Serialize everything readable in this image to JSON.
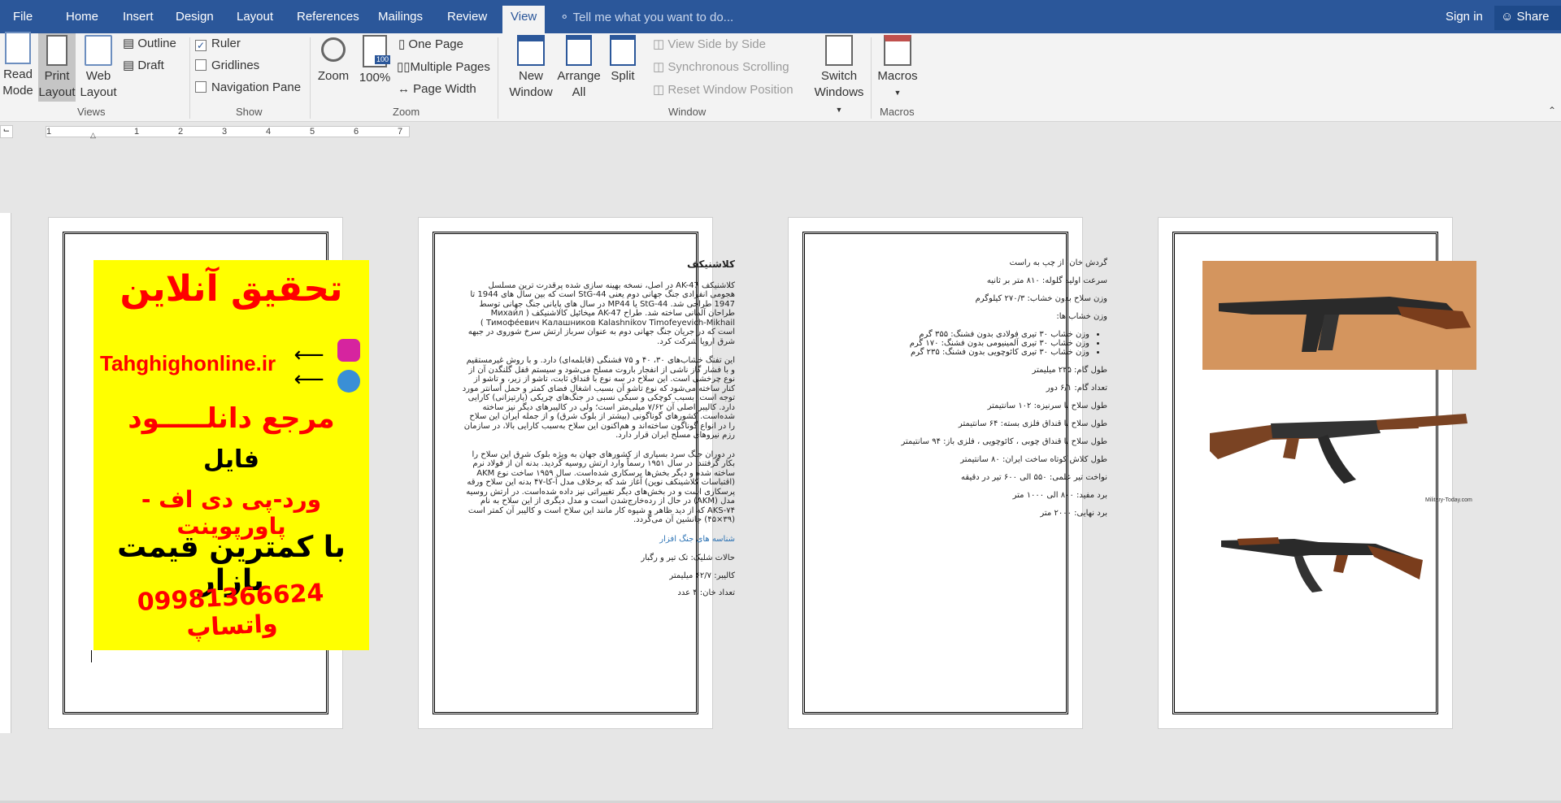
{
  "tabs": {
    "file": "File",
    "home": "Home",
    "insert": "Insert",
    "design": "Design",
    "layout": "Layout",
    "references": "References",
    "mailings": "Mailings",
    "review": "Review",
    "view": "View"
  },
  "tell_me": "Tell me what you want to do...",
  "sign_in": "Sign in",
  "share": "Share",
  "views": {
    "read_mode_1": "Read",
    "read_mode_2": "Mode",
    "print_layout_1": "Print",
    "print_layout_2": "Layout",
    "web_layout_1": "Web",
    "web_layout_2": "Layout",
    "outline": "Outline",
    "draft": "Draft",
    "group": "Views"
  },
  "show": {
    "ruler": "Ruler",
    "gridlines": "Gridlines",
    "navigation_pane": "Navigation Pane",
    "group": "Show"
  },
  "zoom": {
    "zoom": "Zoom",
    "hundred": "100%",
    "one_page": "One Page",
    "multiple_pages": "Multiple Pages",
    "page_width": "Page Width",
    "group": "Zoom",
    "icon_badge": "100"
  },
  "window": {
    "new_window_1": "New",
    "new_window_2": "Window",
    "arrange_all_1": "Arrange",
    "arrange_all_2": "All",
    "split": "Split",
    "view_side_by_side": "View Side by Side",
    "synchronous_scrolling": "Synchronous Scrolling",
    "reset_window_position": "Reset Window Position",
    "switch_windows_1": "Switch",
    "switch_windows_2": "Windows",
    "group": "Window"
  },
  "macros": {
    "label": "Macros",
    "group": "Macros"
  },
  "ruler_numbers": [
    "1",
    "1",
    "2",
    "3",
    "4",
    "5",
    "6",
    "7"
  ],
  "page1": {
    "title": "تحقیق آنلاین",
    "site": "Tahghighonline.ir",
    "line1": "مرجع دانلـــــود",
    "line2": "فایل",
    "line3": "ورد-پی دی اف - پاورپوینت",
    "line4": "با کمترین قیمت بازار",
    "phone": "09981366624",
    "whatsapp": "واتساپ"
  },
  "page2": {
    "heading": "کلاشنیکف",
    "para1": "کلاشنیکف AK-47 در اصل، نسخه بهینه سازی شده پرقدرت ترین مسلسل هجومی انفرادی جنگ جهانی دوم یعنی StG-44 است که بین سال های 1944 تا 1947 طراحی شد. StG-44 یا MP44 در سال های پایانی جنگ جهانی توسط طراحان آلمانی ساخته شد. طراح AK-47 میخائیل کالاشنیکف ( Михаи́л Тимофе́евич Калашников Kalashnikov Timofeyevich-Mikhail ) است که در جریان جنگ جهانی دوم به عنوان سرباز ارتش سرخ شوروی در جبهه شرق اروپا شرکت کرد.",
    "para2": "این تفنگ خشاب‌های ۳۰، ۴۰ و ۷۵ فشنگی (قابلمه‌ای) دارد. و با روش غیرمستقیم و با فشار گاز ناشی از انفجار باروت مسلح می‌شود و سیستم قفل گلنگدن آن از نوع چرخشی است. این سلاح در سه نوع با قنداق ثابت، تاشو از زیر، و تاشو از کنار ساخته می‌شود که نوع تاشو آن بسبب اشغال فضای کمتر و حمل آسانتر مورد توجه است. بسبب کوچکی و سبکی نسبی در جنگ‌های چریکی (پارتیزانی) کارایی دارد. کالیبر اصلی آن ۷/۶۲ میلی‌متر است؛ ولی در کالیبرهای دیگر نیز ساخته شده‌است. کشورهای گوناگونی (بیشتر از بلوک شرق) و از جمله ایران این سلاح را در انواع گوناگون ساخته‌اند و هم‌اکنون این سلاح به‌سبب کارایی بالا، در سازمان رزم نیروهای مسلح ایران قرار دارد.",
    "para3": "در دوران جنگ سرد بسیاری از کشورهای جهان به ویژه بلوک شرق این سلاح را بکار گرفتند. در سال ۱۹۵۱ رسماً وارد ارتش روسیه گردید. بدنه آن از فولاد نرم ساخته شده و دیگر بخش‌ها پرسکاری شده‌است. سال ۱۹۵۹ ساخت نوع AKM (اقتباسات کلاشینکف نوین) آغاز شد که برخلاف مدل آ-کا-۴۷ بدنه این سلاح ورقه پرسکاری است و در بخش‌های دیگر تغییراتی نیز داده شده‌است. در ارتش روسیه مدل (AKM) در حال از رده‌خارج‌شدن است و مدل دیگری از این سلاح به نام AKS-۷۴ که از دید ظاهر و شیوه کار مانند این سلاح است و کالیبر آن کمتر است (۳۹×۴۵) جانشین آن می‌گردد.",
    "sub": "شناسه های جنگ افزار",
    "spec1": "حالات شلیک: تک تیر و رگبار",
    "spec2": "کالیبر: ۶۲/۷ میلیمتر",
    "spec3": "تعداد خان: ۴ عدد"
  },
  "page3": {
    "l1": "گردش خان: از چپ به راست",
    "l2": "سرعت اولیه گلوله: ۸۱۰ متر بر ثانیه",
    "l3": "وزن سلاح بدون خشاب: ۲۷۰/۳ کیلوگرم",
    "l4": "وزن خشاب ها:",
    "b1": "وزن خشاب ۳۰ تیری فولادی بدون فشنگ: ۳۵۵ گرم",
    "b2": "وزن خشاب ۳۰ تیری آلمینیومی بدون فشنگ: ۱۷۰ گرم",
    "b3": "وزن خشاب ۳۰ تیری کائوچویی بدون فشنگ: ۲۳۵ گرم",
    "l5": "طول گام: ۲۳۵ میلیمتر",
    "l6": "تعداد گام: ۶/۱ دور",
    "l7": "طول سلاح با سرنیزه: ۱۰۲ سانتیمتر",
    "l8": "طول سلاح با قنداق فلزی بسته: ۶۴ سانتیمتر",
    "l9": "طول سلاح با قنداق چوبی ، کائوچویی ، فلزی باز: ۹۴ سانتیمتر",
    "l10": "طول کلاش کوتاه ساخت ایران: ۸۰ سانتیمتر",
    "l11": "نواخت تیر علمی: ۵۵۰ الی ۶۰۰ تیر در دقیقه",
    "l12": "برد مفید: ۸۰۰ الی ۱۰۰۰ متر",
    "l13": "برد نهایی: ۲۰۰۰ متر"
  },
  "page4": {
    "credit": "Military-Today.com"
  },
  "colors": {
    "titlebar": "#2b579a",
    "ad_bg": "#ffff00",
    "ad_red": "#ff0000"
  }
}
